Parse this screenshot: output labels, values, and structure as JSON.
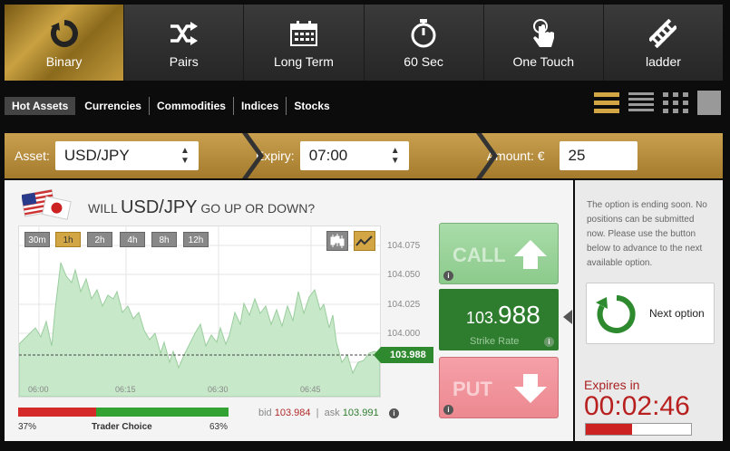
{
  "nav": {
    "items": [
      {
        "label": "Binary",
        "icon": "refresh-icon",
        "active": true
      },
      {
        "label": "Pairs",
        "icon": "shuffle-icon",
        "active": false
      },
      {
        "label": "Long Term",
        "icon": "calendar-icon",
        "active": false
      },
      {
        "label": "60 Sec",
        "icon": "stopwatch-icon",
        "active": false
      },
      {
        "label": "One Touch",
        "icon": "touch-icon",
        "active": false
      },
      {
        "label": "ladder",
        "icon": "ladder-icon",
        "active": false
      }
    ]
  },
  "filters": [
    "Hot Assets",
    "Currencies",
    "Commodities",
    "Indices",
    "Stocks"
  ],
  "trade_bar": {
    "asset_label": "Asset:",
    "asset_value": "USD/JPY",
    "expiry_label": "Expiry:",
    "expiry_value": "07:00",
    "amount_label": "Amount: €",
    "amount_value": "25"
  },
  "question": {
    "prefix": "WILL",
    "asset": "USD/JPY",
    "suffix": "GO UP OR DOWN?"
  },
  "timeframes": [
    "30m",
    "1h",
    "2h",
    "4h",
    "8h",
    "12h"
  ],
  "active_timeframe": "1h",
  "chart": {
    "y_ticks": [
      "104.075",
      "104.050",
      "104.025",
      "104.000"
    ],
    "x_ticks": [
      "06:00",
      "06:15",
      "06:30",
      "06:45"
    ],
    "current_price": "103.988"
  },
  "call_label": "CALL",
  "put_label": "PUT",
  "strike": {
    "prefix": "103.",
    "main": "988",
    "label": "Strike Rate"
  },
  "sentiment": {
    "put_pct": "37%",
    "label": "Trader Choice",
    "call_pct": "63%",
    "put_frac": 0.37
  },
  "bid_ask": {
    "bid_label": "bid",
    "bid": "103.984",
    "ask_label": "ask",
    "ask": "103.991"
  },
  "notice": "The option is ending soon. No positions can be submitted now. Please use the button below to advance to the next available option.",
  "next_option": "Next option",
  "expires": {
    "label": "Expires in",
    "time": "00:02:46",
    "progress": 0.44
  },
  "colors": {
    "gold": "#c9a050",
    "green": "#2e7d2e",
    "red": "#c22222"
  }
}
